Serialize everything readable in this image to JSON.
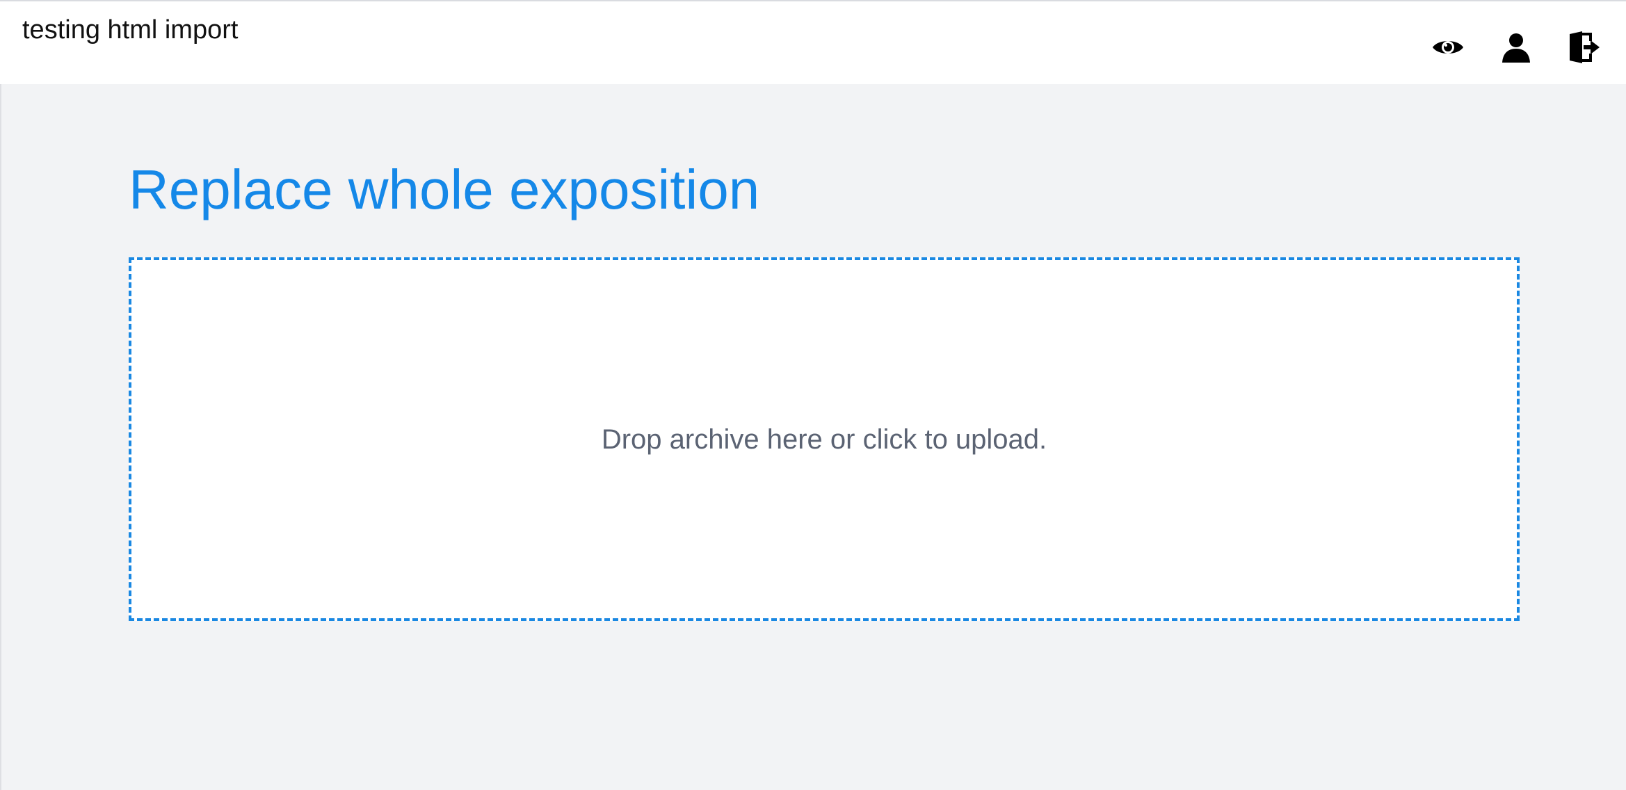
{
  "header": {
    "title": "testing html import",
    "actions": [
      {
        "icon": "eye-icon"
      },
      {
        "icon": "user-icon"
      },
      {
        "icon": "logout-door-icon"
      }
    ]
  },
  "main": {
    "title": "Replace whole exposition",
    "dropzone": {
      "text": "Drop archive here or click to upload."
    }
  },
  "colors": {
    "accent": "#1588e8",
    "dropzone_border": "#1a88e2",
    "background": "#f2f3f5",
    "header_background": "#ffffff",
    "muted_text": "#5b6373"
  }
}
